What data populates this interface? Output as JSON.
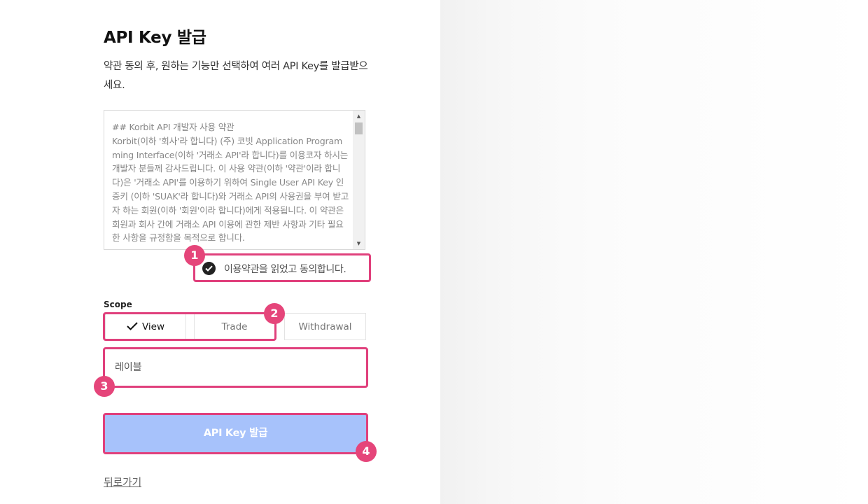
{
  "page": {
    "title": "API Key 발급",
    "description": "약관 동의 후, 원하는 기능만 선택하여 여러 API Key를 발급받으세요."
  },
  "terms": {
    "text": "## Korbit API 개발자 사용 약관\nKorbit(이하 '회사'라 합니다) (주) 코빗 Application Programming Interface(이하 '거래소 API'라 합니다)를 이용코자 하시는 개발자 분들께 감사드립니다. 이 사용 약관(이하 '약관'이라 합니다)은 '거래소 API'를 이용하기 위하여 Single User API Key 인증키 (이하 'SUAK'라 합니다)와 거래소 API의 사용권을 부여 받고자 하는 회원(이하 '회원'이라 합니다)에게 적용됩니다. 이 약관은 회원과 회사 간에 거래소 API 이용에 관한 제반 사항과 기타 필요한 사항을 규정함을 목적으로 합니다.",
    "agree_label": "이용약관을 읽었고 동의합니다.",
    "agreed": true
  },
  "scope": {
    "label": "Scope",
    "options": [
      {
        "label": "View",
        "selected": true
      },
      {
        "label": "Trade",
        "selected": false
      },
      {
        "label": "Withdrawal",
        "selected": false
      }
    ]
  },
  "label_input": {
    "placeholder": "레이블",
    "value": ""
  },
  "submit": {
    "label": "API Key 발급"
  },
  "back_link": {
    "label": "뒤로가기"
  },
  "annotations": {
    "badge_1": "1",
    "badge_2": "2",
    "badge_3": "3",
    "badge_4": "4"
  },
  "colors": {
    "highlight": "#e0407c",
    "badge": "#e5457a",
    "submit_bg": "#a7c2fb"
  }
}
